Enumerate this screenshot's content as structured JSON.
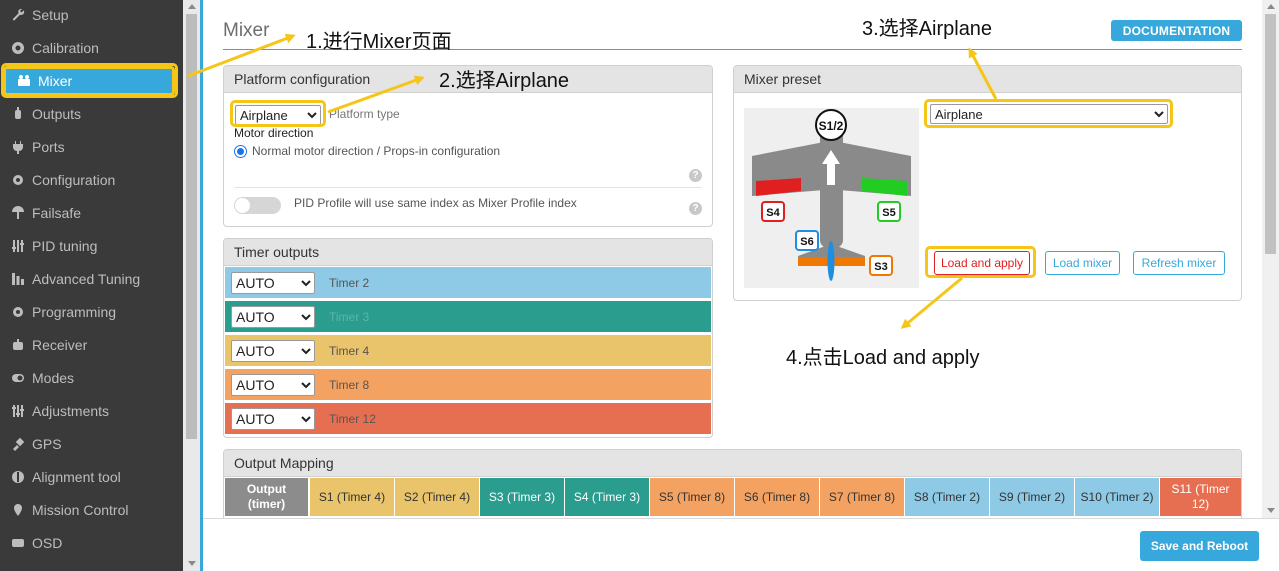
{
  "sidebar": {
    "items": [
      {
        "label": "Setup",
        "icon": "wrench-icon"
      },
      {
        "label": "Calibration",
        "icon": "crosshair-icon"
      },
      {
        "label": "Mixer",
        "icon": "mixer-icon",
        "active": true
      },
      {
        "label": "Outputs",
        "icon": "motor-icon"
      },
      {
        "label": "Ports",
        "icon": "plug-icon"
      },
      {
        "label": "Configuration",
        "icon": "gear-icon"
      },
      {
        "label": "Failsafe",
        "icon": "parachute-icon"
      },
      {
        "label": "PID tuning",
        "icon": "sliders-icon"
      },
      {
        "label": "Advanced Tuning",
        "icon": "tuning-icon"
      },
      {
        "label": "Programming",
        "icon": "gear-icon"
      },
      {
        "label": "Receiver",
        "icon": "robot-icon"
      },
      {
        "label": "Modes",
        "icon": "toggle-icon"
      },
      {
        "label": "Adjustments",
        "icon": "adjust-icon"
      },
      {
        "label": "GPS",
        "icon": "satellite-icon"
      },
      {
        "label": "Alignment tool",
        "icon": "align-icon"
      },
      {
        "label": "Mission Control",
        "icon": "map-pin-icon"
      },
      {
        "label": "OSD",
        "icon": "osd-icon"
      }
    ]
  },
  "header": {
    "title": "Mixer",
    "documentation_label": "DOCUMENTATION"
  },
  "platform": {
    "title": "Platform configuration",
    "type_value": "Airplane",
    "type_label": "Platform type",
    "motor_direction_label": "Motor direction",
    "motor_direction_option": "Normal motor direction / Props-in configuration",
    "pid_profile_label": "PID Profile will use same index as Mixer Profile index"
  },
  "timers": {
    "title": "Timer outputs",
    "rows": [
      {
        "mode": "AUTO",
        "label": "Timer 2",
        "color": "#8ecae6"
      },
      {
        "mode": "AUTO",
        "label": "Timer 3",
        "color": "#2a9d8f"
      },
      {
        "mode": "AUTO",
        "label": "Timer 4",
        "color": "#e9c46a"
      },
      {
        "mode": "AUTO",
        "label": "Timer 8",
        "color": "#f4a261"
      },
      {
        "mode": "AUTO",
        "label": "Timer 12",
        "color": "#e76f51"
      }
    ]
  },
  "preset": {
    "title": "Mixer preset",
    "value": "Airplane",
    "load_apply_label": "Load and apply",
    "load_mixer_label": "Load mixer",
    "refresh_mixer_label": "Refresh mixer",
    "servo_labels": {
      "s12": "S1/2",
      "s4": "S4",
      "s5": "S5",
      "s6": "S6",
      "s3": "S3"
    }
  },
  "output_mapping": {
    "title": "Output Mapping",
    "header_label": "Output (timer)",
    "cells": [
      {
        "label": "S1 (Timer 4)",
        "color": "#e9c46a"
      },
      {
        "label": "S2 (Timer 4)",
        "color": "#e9c46a"
      },
      {
        "label": "S3 (Timer 3)",
        "color": "#2a9d8f"
      },
      {
        "label": "S4 (Timer 3)",
        "color": "#2a9d8f"
      },
      {
        "label": "S5 (Timer 8)",
        "color": "#f4a261"
      },
      {
        "label": "S6 (Timer 8)",
        "color": "#f4a261"
      },
      {
        "label": "S7 (Timer 8)",
        "color": "#f4a261"
      },
      {
        "label": "S8 (Timer 2)",
        "color": "#8ecae6"
      },
      {
        "label": "S9 (Timer 2)",
        "color": "#8ecae6"
      },
      {
        "label": "S10 (Timer 2)",
        "color": "#8ecae6"
      },
      {
        "label": "S11 (Timer 12)",
        "color": "#e76f51"
      }
    ]
  },
  "footer": {
    "save_label": "Save and Reboot"
  },
  "annotations": {
    "step1": "1.进行Mixer页面",
    "step2": "2.选择Airplane",
    "step3": "3.选择Airplane",
    "step4": "4.点击Load and apply"
  },
  "colors": {
    "accent": "#37a8db",
    "highlight": "#f5c518"
  }
}
